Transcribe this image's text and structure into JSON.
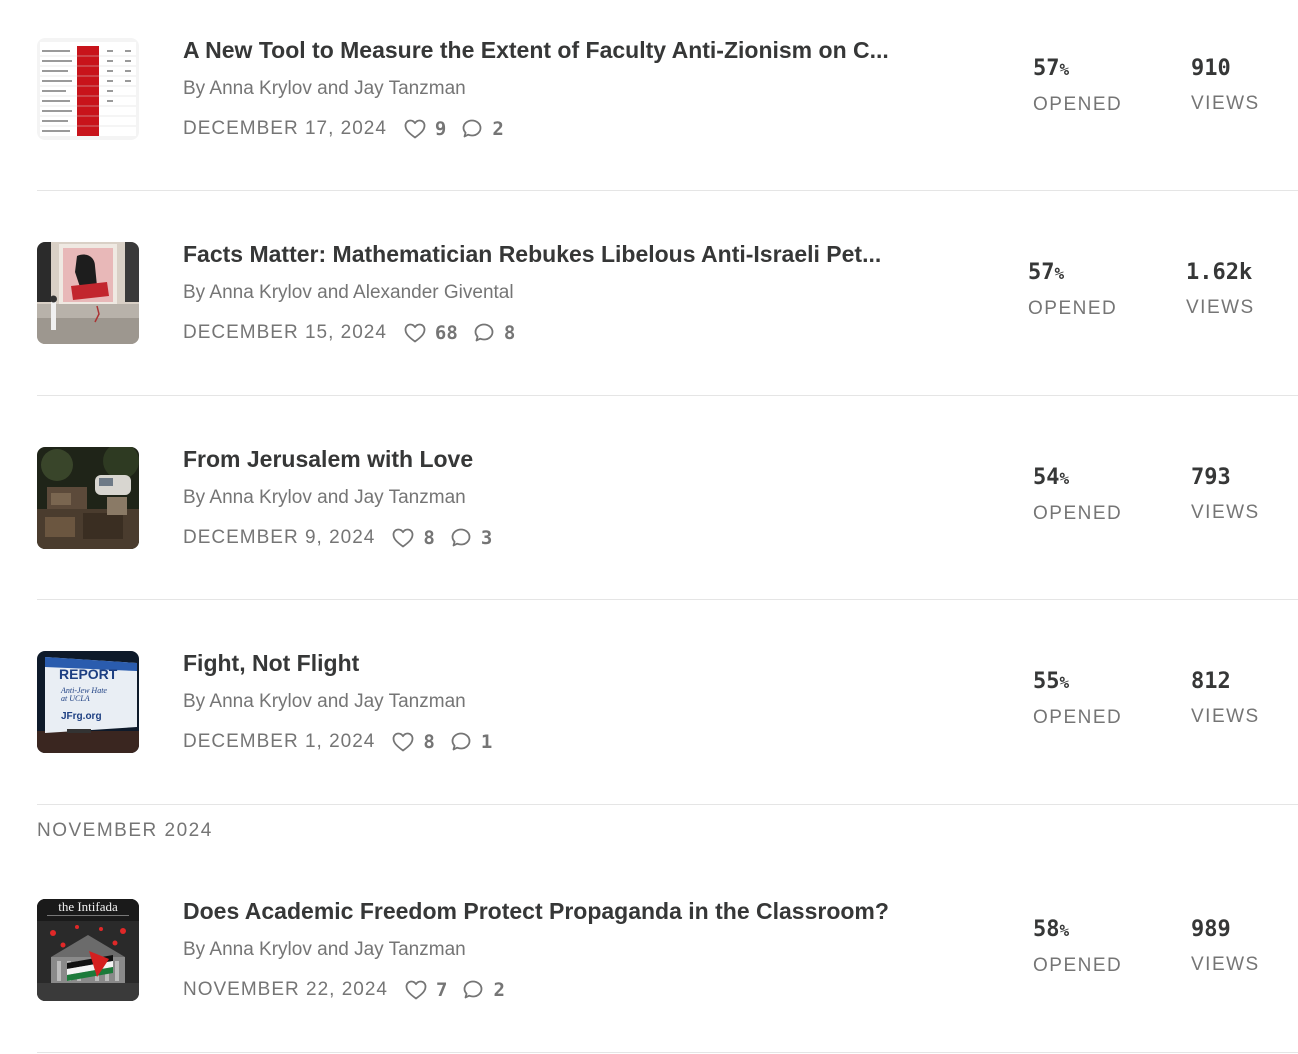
{
  "posts": [
    {
      "title": "A New Tool to Measure the Extent of Faculty Anti-Zionism on C...",
      "byline": "By Anna Krylov and Jay Tanzman",
      "date": "DECEMBER 17, 2024",
      "likes": "9",
      "comments": "2",
      "opened_value": "57",
      "opened_unit": "%",
      "opened_label": "OPENED",
      "views_value": "910",
      "views_label": "VIEWS",
      "thumb_icon": "spreadsheet-thumbnail"
    },
    {
      "title": "Facts Matter: Mathematician Rebukes Libelous Anti-Israeli Pet...",
      "byline": "By Anna Krylov and Alexander Givental",
      "date": "DECEMBER 15, 2024",
      "likes": "68",
      "comments": "8",
      "opened_value": "57",
      "opened_unit": "%",
      "opened_label": "OPENED",
      "views_value": "1.62k",
      "views_label": "VIEWS",
      "thumb_icon": "poster-wall-thumbnail"
    },
    {
      "title": "From Jerusalem with Love",
      "byline": "By Anna Krylov and Jay Tanzman",
      "date": "DECEMBER 9, 2024",
      "likes": "8",
      "comments": "3",
      "opened_value": "54",
      "opened_unit": "%",
      "opened_label": "OPENED",
      "views_value": "793",
      "views_label": "VIEWS",
      "thumb_icon": "street-photo-thumbnail"
    },
    {
      "title": "Fight, Not Flight",
      "byline": "By Anna Krylov and Jay Tanzman",
      "date": "DECEMBER 1, 2024",
      "likes": "8",
      "comments": "1",
      "opened_value": "55",
      "opened_unit": "%",
      "opened_label": "OPENED",
      "views_value": "812",
      "views_label": "VIEWS",
      "thumb_icon": "billboard-thumbnail",
      "thumb_text": [
        "REPORT",
        "Anti-Jew Hate",
        "at UCLA",
        "JFrg.org"
      ]
    },
    {
      "title": "Does Academic Freedom Protect Propaganda in the Classroom?",
      "byline": "By Anna Krylov and Jay Tanzman",
      "date": "NOVEMBER 22, 2024",
      "likes": "7",
      "comments": "2",
      "opened_value": "58",
      "opened_unit": "%",
      "opened_label": "OPENED",
      "views_value": "989",
      "views_label": "VIEWS",
      "thumb_icon": "magazine-cover-thumbnail",
      "thumb_text": [
        "the Intifada"
      ]
    }
  ],
  "section_heading": "NOVEMBER 2024",
  "colors": {
    "title": "#363737",
    "muted": "#757575",
    "divider": "#e5e5e5"
  }
}
